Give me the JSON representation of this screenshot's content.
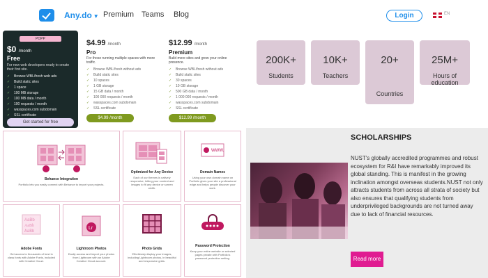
{
  "nav": {
    "brand": "Any.do",
    "links": [
      "Premium",
      "Teams",
      "Blog"
    ],
    "login": "Login",
    "lang": "EN"
  },
  "pricing": {
    "free": {
      "badge": "POPP",
      "price": "$0",
      "per": "/month",
      "name": "Free",
      "desc": "For new web developers ready to create their first site.",
      "features": [
        "Browse WBL/fresh web ads",
        "Build static sites",
        "1 space",
        "100 MB storage",
        "100 MB data / month",
        "100 requests / month",
        "wasspaces.com subdomain",
        "SSL certificate"
      ],
      "cta": "Get started for free"
    },
    "pro": {
      "price": "$4.99",
      "per": "/month",
      "name": "Pro",
      "desc": "For those running multiple spaces with more traffic.",
      "features": [
        "Browse WBL/fresh without ads",
        "Build static sites",
        "10 spaces",
        "1 GB storage",
        "15 GB data / month",
        "100 000 requests / month",
        "wasspaces.com subdomain",
        "SSL certificate"
      ],
      "cta": "$4.99 /month"
    },
    "premium": {
      "price": "$12.99",
      "per": "/month",
      "name": "Premium",
      "desc": "Build more sites and grow your online presence.",
      "features": [
        "Browse WBL/fresh without ads",
        "Build static sites",
        "30 spaces",
        "10 GB storage",
        "500 GB data / month",
        "1 000 000 requests / month",
        "wasspaces.com subdomain",
        "SSL certificate"
      ],
      "cta": "$12.99 /month"
    }
  },
  "stats": [
    {
      "value": "200K+",
      "label": "Students"
    },
    {
      "value": "10K+",
      "label": "Teachers"
    },
    {
      "value": "20+",
      "label": "Countries"
    },
    {
      "value": "25M+",
      "label": "Hours of education"
    }
  ],
  "features": [
    {
      "title": "Behance Integration",
      "desc": "Portfolio lets you easily connect with Behance to import your projects."
    },
    {
      "title": "Optimized for Any Device",
      "desc": "Each of our themes is natively responsive, letting your content and images to fit any device or screen width."
    },
    {
      "title": "Domain Names",
      "desc": "Using your own domain name on Portfolio gives your site a professional edge and helps people discover your work."
    },
    {
      "title": "Adobe Fonts",
      "desc": "Get access to thousands of best in class fonts with Adobe Fonts, included with Creative Cloud."
    },
    {
      "title": "Lightroom Photos",
      "desc": "Easily access and import your photos from Lightroom with an Adobe Creative Cloud account."
    },
    {
      "title": "Photo Grids",
      "desc": "Effortlessly display your images, including Lightroom photos, in beautiful and responsive grids."
    },
    {
      "title": "Password Protection",
      "desc": "Keep your entire website or selected pages private with Portfolio's password protection setting."
    }
  ],
  "scholarship": {
    "title": "SCHOLARSHIPS",
    "text": "NUST's globally accredited programmes and robust ecosystem for R&I have remarkably improved its global standing. This is manifest in the growing inclination amongst overseas students.NUST not only attracts students from across all strata of society but also ensures that qualifying students from underprivileged backgrounds are not turned away due to lack of financial resources.",
    "button": "Read more"
  },
  "colors": {
    "brand_blue": "#1e8eea",
    "stat_bg": "#dcc9d6",
    "accent_pink": "#e01c91",
    "plan_green": "#7f9a1f",
    "free_card_bg": "#1b2a2a"
  }
}
